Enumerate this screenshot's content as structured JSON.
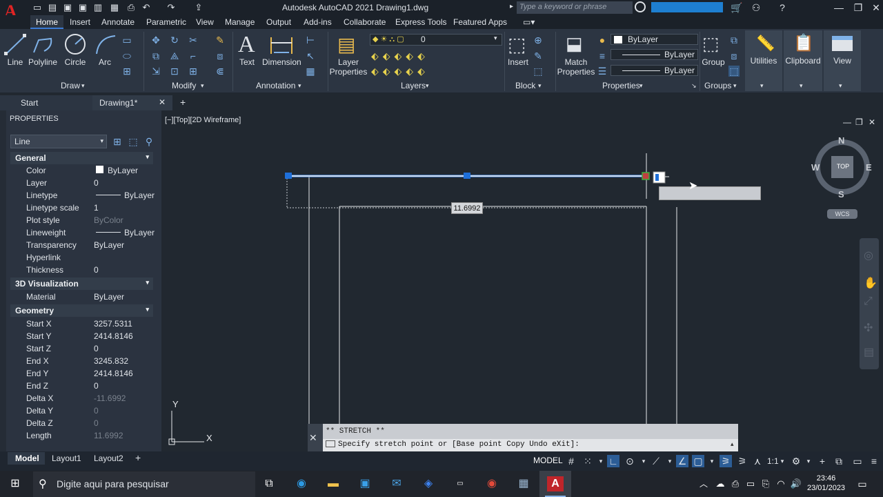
{
  "app": {
    "title": "Autodesk AutoCAD 2021   Drawing1.dwg",
    "logo_letter": "A",
    "search_placeholder": "Type a keyword or phrase"
  },
  "ribbon_tabs": [
    "Home",
    "Insert",
    "Annotate",
    "Parametric",
    "View",
    "Manage",
    "Output",
    "Add-ins",
    "Collaborate",
    "Express Tools",
    "Featured Apps"
  ],
  "ribbon": {
    "draw": {
      "line": "Line",
      "polyline": "Polyline",
      "circle": "Circle",
      "arc": "Arc",
      "title": "Draw"
    },
    "modify_title": "Modify",
    "annotation": {
      "text": "Text",
      "dimension": "Dimension",
      "title": "Annotation"
    },
    "layers": {
      "layer_properties": "Layer\nProperties",
      "current_layer": "0",
      "title": "Layers"
    },
    "block": {
      "insert": "Insert",
      "title": "Block"
    },
    "properties": {
      "match": "Match\nProperties",
      "color": "ByLayer",
      "linetype": "ByLayer",
      "lineweight": "ByLayer",
      "title": "Properties"
    },
    "groups": {
      "group": "Group",
      "title": "Groups"
    },
    "utilities": "Utilities",
    "clipboard": "Clipboard",
    "view": "View"
  },
  "file_tabs": {
    "start": "Start",
    "drawing": "Drawing1*"
  },
  "properties_palette": {
    "title": "PROPERTIES",
    "object_type": "Line",
    "sections": [
      {
        "name": "General",
        "rows": [
          {
            "label": "Color",
            "value": "ByLayer"
          },
          {
            "label": "Layer",
            "value": "0"
          },
          {
            "label": "Linetype",
            "value": "ByLayer"
          },
          {
            "label": "Linetype scale",
            "value": "1"
          },
          {
            "label": "Plot style",
            "value": "ByColor"
          },
          {
            "label": "Lineweight",
            "value": "ByLayer"
          },
          {
            "label": "Transparency",
            "value": "ByLayer"
          },
          {
            "label": "Hyperlink",
            "value": ""
          },
          {
            "label": "Thickness",
            "value": "0"
          }
        ]
      },
      {
        "name": "3D Visualization",
        "rows": [
          {
            "label": "Material",
            "value": "ByLayer"
          }
        ]
      },
      {
        "name": "Geometry",
        "rows": [
          {
            "label": "Start X",
            "value": "3257.5311"
          },
          {
            "label": "Start Y",
            "value": "2414.8146"
          },
          {
            "label": "Start Z",
            "value": "0"
          },
          {
            "label": "End X",
            "value": "3245.832"
          },
          {
            "label": "End Y",
            "value": "2414.8146"
          },
          {
            "label": "End Z",
            "value": "0"
          },
          {
            "label": "Delta X",
            "value": "-11.6992"
          },
          {
            "label": "Delta Y",
            "value": "0"
          },
          {
            "label": "Delta Z",
            "value": "0"
          },
          {
            "label": "Length",
            "value": "11.6992"
          }
        ]
      }
    ]
  },
  "viewport": {
    "label": "[−][Top][2D Wireframe]",
    "dimension_tooltip": "11.6992",
    "viewcube": {
      "n": "N",
      "s": "S",
      "e": "E",
      "w": "W",
      "top": "TOP",
      "wcs": "WCS"
    },
    "ucs_x": "X",
    "ucs_y": "Y"
  },
  "command": {
    "history": "** STRETCH **",
    "prompt": "Specify stretch point or [Base point Copy Undo eXit]:"
  },
  "layout_tabs": [
    "Model",
    "Layout1",
    "Layout2"
  ],
  "status": {
    "model": "MODEL",
    "scale": "1:1"
  },
  "taskbar": {
    "search": "Digite aqui para pesquisar",
    "time": "23:46",
    "date": "23/01/2023"
  },
  "colors": {
    "selected_line": "#4d8fe8",
    "grip": "#1e6fd9",
    "autocad_red": "#e02424"
  }
}
